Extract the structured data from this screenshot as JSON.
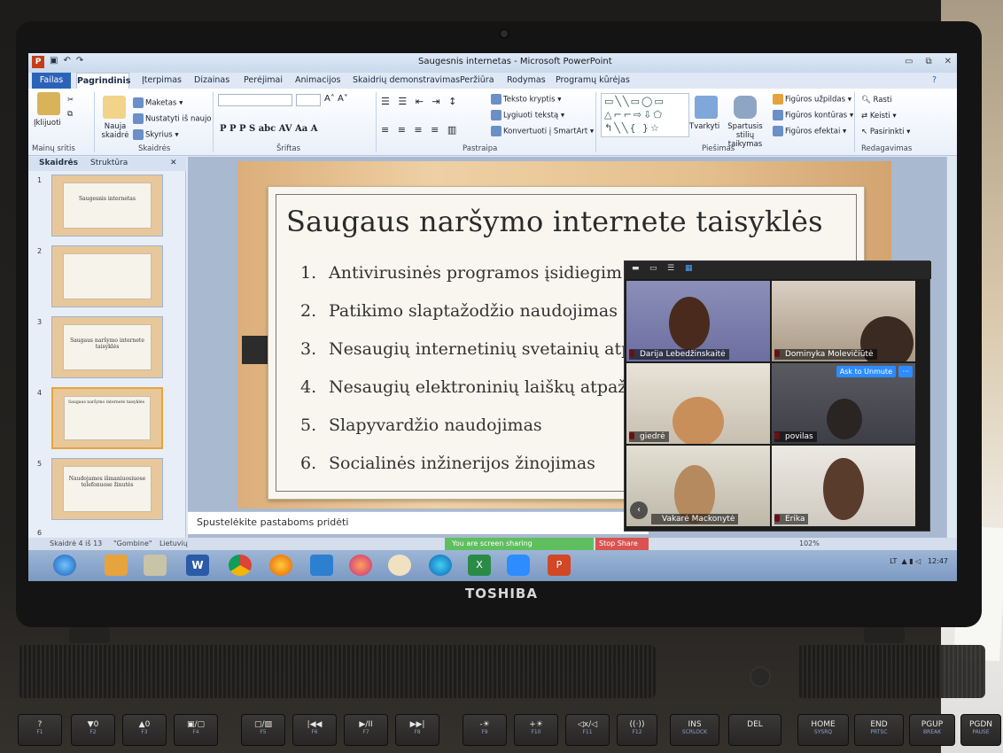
{
  "window": {
    "title": "Saugesnis internetas - Microsoft PowerPoint",
    "app_icon": "P"
  },
  "ribbon_tabs": [
    "Failas",
    "Pagrindinis",
    "Įterpimas",
    "Dizainas",
    "Perėjimai",
    "Animacijos",
    "Skaidrių demonstravimas",
    "Peržiūra",
    "Rodymas",
    "Programų kūrėjas"
  ],
  "ribbon": {
    "paste": "Įklijuoti",
    "clipboard_group": "Mainų sritis",
    "new_slide": "Nauja skaidrė",
    "layout": "Maketas",
    "reset": "Nustatyti iš naujo",
    "section": "Skyrius",
    "slides_group": "Skaidrės",
    "font_group": "Šriftas",
    "font_tools": "P  P  P  S  abc  AV  Aa  A",
    "paragraph_group": "Pastraipa",
    "text_direction": "Teksto kryptis",
    "align_text": "Lygiuoti tekstą",
    "convert_smartart": "Konvertuoti į SmartArt",
    "arrange": "Tvarkyti",
    "quick_styles": "Spartusis stilių taikymas",
    "shape_fill": "Figūros užpildas",
    "shape_outline": "Figūros kontūras",
    "shape_effects": "Figūros efektai",
    "drawing_group": "Piešimas",
    "find": "Rasti",
    "replace": "Keisti",
    "select": "Pasirinkti",
    "editing_group": "Redagavimas"
  },
  "left_pane": {
    "tab_slides": "Skaidrės",
    "tab_outline": "Struktūra",
    "thumbs": [
      {
        "num": "1",
        "text": "Saugesnis internetas"
      },
      {
        "num": "2",
        "text": ""
      },
      {
        "num": "3",
        "text": "Saugaus naršymo internete taisyklės"
      },
      {
        "num": "4",
        "text": "Saugaus naršymo internete taisyklės"
      },
      {
        "num": "5",
        "text": "Naudojamos išmaniuosiuose telefonuose žinutės"
      },
      {
        "num": "6",
        "text": ""
      }
    ]
  },
  "slide": {
    "title": "Saugaus naršymo internete taisyklės",
    "items": [
      {
        "n": "1.",
        "text": "Antivirusinės programos įsidiegim"
      },
      {
        "n": "2.",
        "text": "Patikimo slaptažodžio naudojimas"
      },
      {
        "n": "3.",
        "text": "Nesaugių internetinių svetainių atp"
      },
      {
        "n": "4.",
        "text": "Nesaugių elektroninių laiškų atpaž"
      },
      {
        "n": "5.",
        "text": "Slapyvardžio naudojimas"
      },
      {
        "n": "6.",
        "text": "Socialinės inžinerijos žinojimas"
      }
    ]
  },
  "notes_placeholder": "Spustelėkite pastaboms pridėti",
  "status": {
    "slide_of": "Skaidrė 4 iš 13",
    "theme": "\"Gombine\"",
    "language": "Lietuvių",
    "zoom": "102%"
  },
  "share": {
    "sharing": "You are screen sharing",
    "stop": "Stop Share"
  },
  "zoom_participants": [
    {
      "name": "Darija Lebedžinskaitė"
    },
    {
      "name": "Dominyka Molevičiūtė"
    },
    {
      "name": "giedrė"
    },
    {
      "name": "povilas"
    },
    {
      "name": "Vakarė Mackonytė"
    },
    {
      "name": "Erika"
    }
  ],
  "zoom_controls": {
    "ask_unmute": "Ask to Unmute",
    "more": "···"
  },
  "tray": {
    "lang": "LT",
    "time": "12:47"
  },
  "brand": "TOSHIBA",
  "keyboard": [
    {
      "label": "?",
      "sub": "F1"
    },
    {
      "label": "▼0",
      "sub": "F2"
    },
    {
      "label": "▲0",
      "sub": "F3"
    },
    {
      "label": "▣/▢",
      "sub": "F4"
    },
    {
      "label": "▢/▨",
      "sub": "F5"
    },
    {
      "label": "|◀◀",
      "sub": "F6"
    },
    {
      "label": "▶/II",
      "sub": "F7"
    },
    {
      "label": "▶▶|",
      "sub": "F8"
    },
    {
      "label": "-☀",
      "sub": "F9"
    },
    {
      "label": "+☀",
      "sub": "F10"
    },
    {
      "label": "◁x/◁",
      "sub": "F11"
    },
    {
      "label": "((·))",
      "sub": "F12"
    },
    {
      "label": "INS",
      "sub": "SCRLOCK"
    },
    {
      "label": "DEL",
      "sub": ""
    },
    {
      "label": "HOME",
      "sub": "SYSRQ"
    },
    {
      "label": "END",
      "sub": "PRTSC"
    },
    {
      "label": "PGUP",
      "sub": "BREAK"
    },
    {
      "label": "PGDN",
      "sub": "PAUSE"
    }
  ],
  "colors": {
    "file_tab": "#2b63b8",
    "share_bar": "#5fbf5f",
    "stop_share": "#d9534f",
    "zoom_blue": "#2d8cff",
    "slide_bg": "#e5c08f"
  }
}
